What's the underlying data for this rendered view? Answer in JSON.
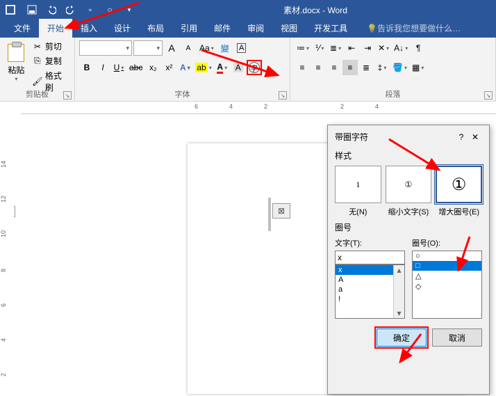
{
  "title": "素材.docx - Word",
  "tabs": {
    "file": "文件",
    "home": "开始",
    "insert": "插入",
    "design": "设计",
    "layout": "布局",
    "references": "引用",
    "mailings": "邮件",
    "review": "审阅",
    "view": "视图",
    "dev": "开发工具",
    "tell": "告诉我您想要做什么…"
  },
  "clipboard": {
    "label": "剪贴板",
    "paste": "粘贴",
    "cut": "剪切",
    "copy": "复制",
    "painter": "格式刷"
  },
  "font": {
    "label": "字体",
    "increase": "A",
    "decrease": "A",
    "clear": "Aa",
    "phonetic": "㋐",
    "charborder": "A",
    "bold": "B",
    "italic": "I",
    "underline": "U",
    "strike": "abc",
    "sub": "x₂",
    "sup": "x²",
    "texteffects": "A",
    "highlight": "ab",
    "color": "A",
    "charshade": "A",
    "enclose": "字"
  },
  "paragraph": {
    "label": "段落"
  },
  "ruler_h": [
    "6",
    "4",
    "2",
    "2",
    "4"
  ],
  "ruler_v": [
    "14",
    "12",
    "10",
    "8",
    "6",
    "4",
    "2"
  ],
  "L": "L",
  "dialog": {
    "title": "带圈字符",
    "help": "?",
    "close": "✕",
    "style_label": "样式",
    "styles": [
      {
        "g": "1",
        "l": "无(N)"
      },
      {
        "g": "①",
        "l": "缩小文字(S)"
      },
      {
        "g": "①",
        "l": "增大圈号(E)"
      }
    ],
    "enclose_label": "圈号",
    "text_label": "文字(T):",
    "text_value": "x",
    "text_options": [
      "x",
      "A",
      "a",
      "!"
    ],
    "ring_label": "圈号(O):",
    "ring_options": [
      "○",
      "□",
      "△",
      "◇"
    ],
    "ok": "确定",
    "cancel": "取消"
  }
}
